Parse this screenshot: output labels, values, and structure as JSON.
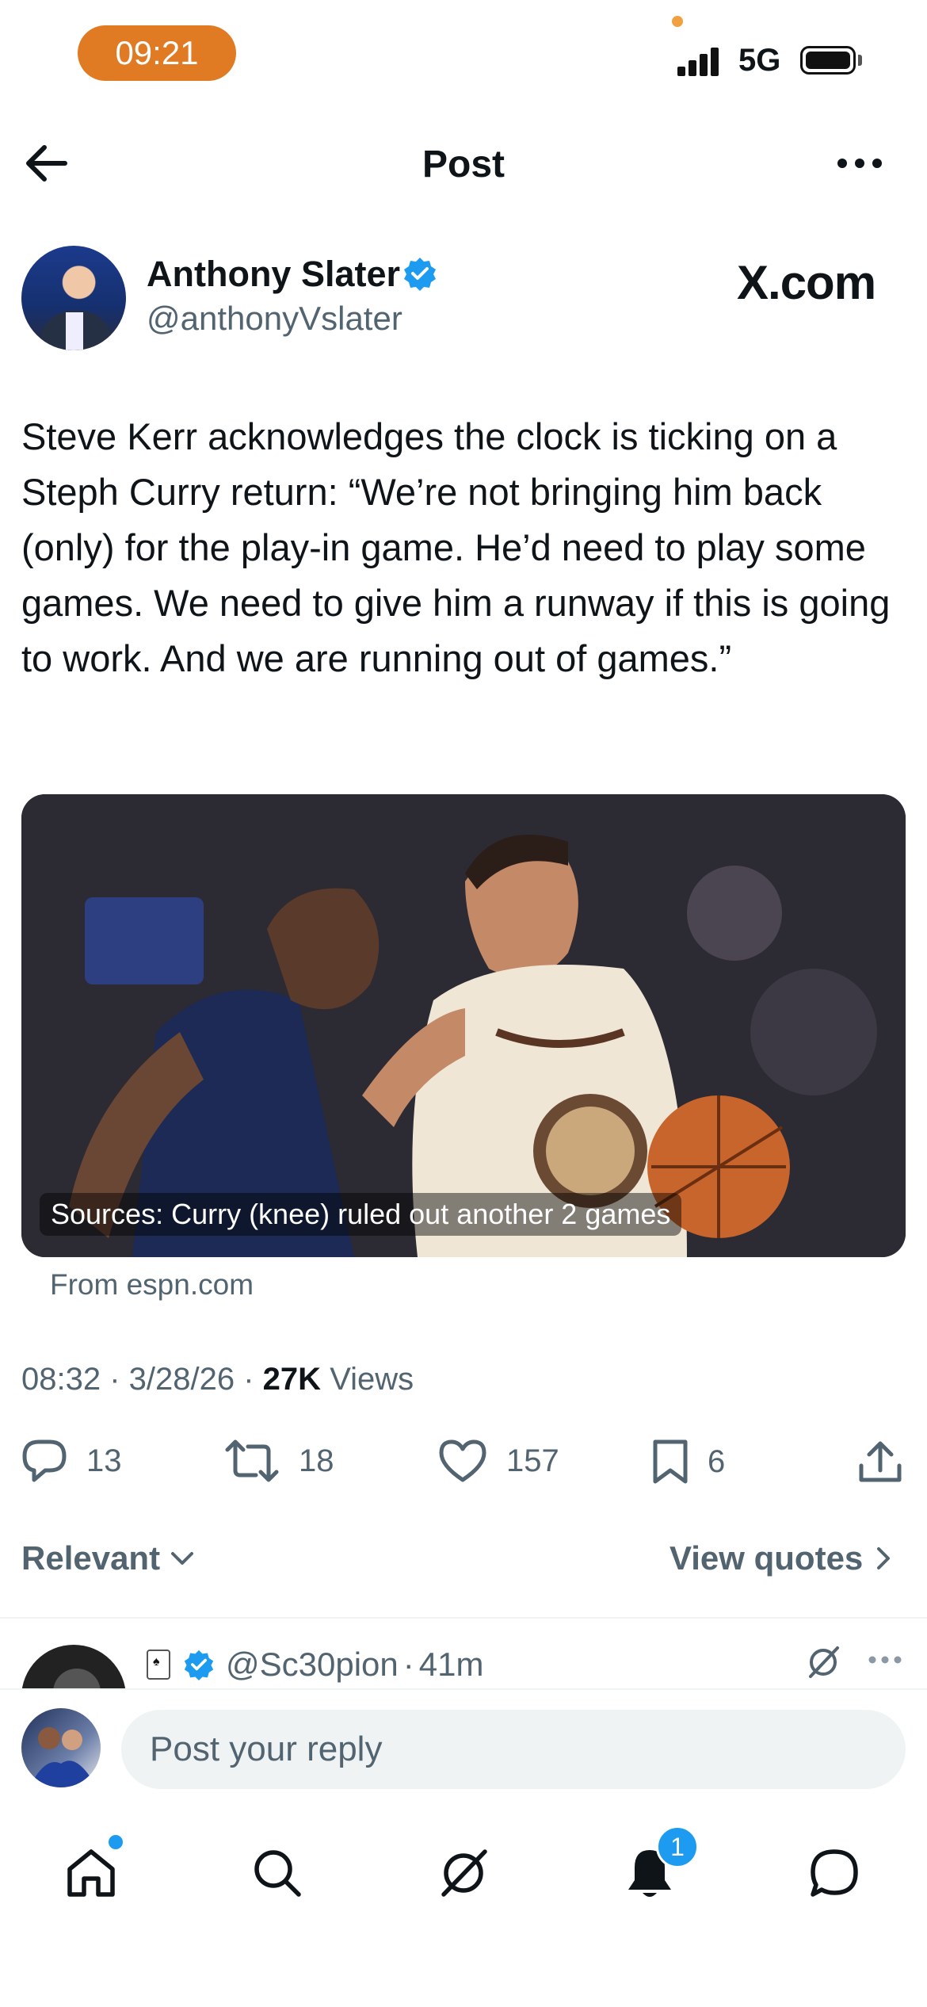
{
  "status_bar": {
    "time": "09:21",
    "network": "5G"
  },
  "header": {
    "title": "Post",
    "back_icon": "arrow-left-icon",
    "more_icon": "more-horizontal-icon"
  },
  "author": {
    "name": "Anthony Slater",
    "handle": "@anthonyVslater",
    "source_label": "X.com",
    "verified_color": "#1d9bf0"
  },
  "tweet": {
    "text": "Steve Kerr acknowledges the clock is ticking on a Steph Curry return: “We’re not bringing him back (only) for the play-in game. He’d need to play some games. We need to give him a runway if this is going to work. And we are running out of games.”"
  },
  "link_card": {
    "caption": "Sources: Curry (knee) ruled out another 2 games",
    "source": "From espn.com"
  },
  "meta": {
    "time": "08:32",
    "date": "3/28/26",
    "views_count": "27K",
    "views_label": "Views"
  },
  "actions": {
    "replies": "13",
    "reposts": "18",
    "likes": "157",
    "bookmarks": "6"
  },
  "sort": {
    "label": "Relevant",
    "view_quotes": "View quotes"
  },
  "reply_preview": {
    "handle": "@Sc30pion",
    "separator": "·",
    "time": "41m"
  },
  "reply_input": {
    "placeholder": "Post your reply"
  },
  "bottom_nav": {
    "notification_count": "1",
    "accent": "#1d9bf0"
  }
}
